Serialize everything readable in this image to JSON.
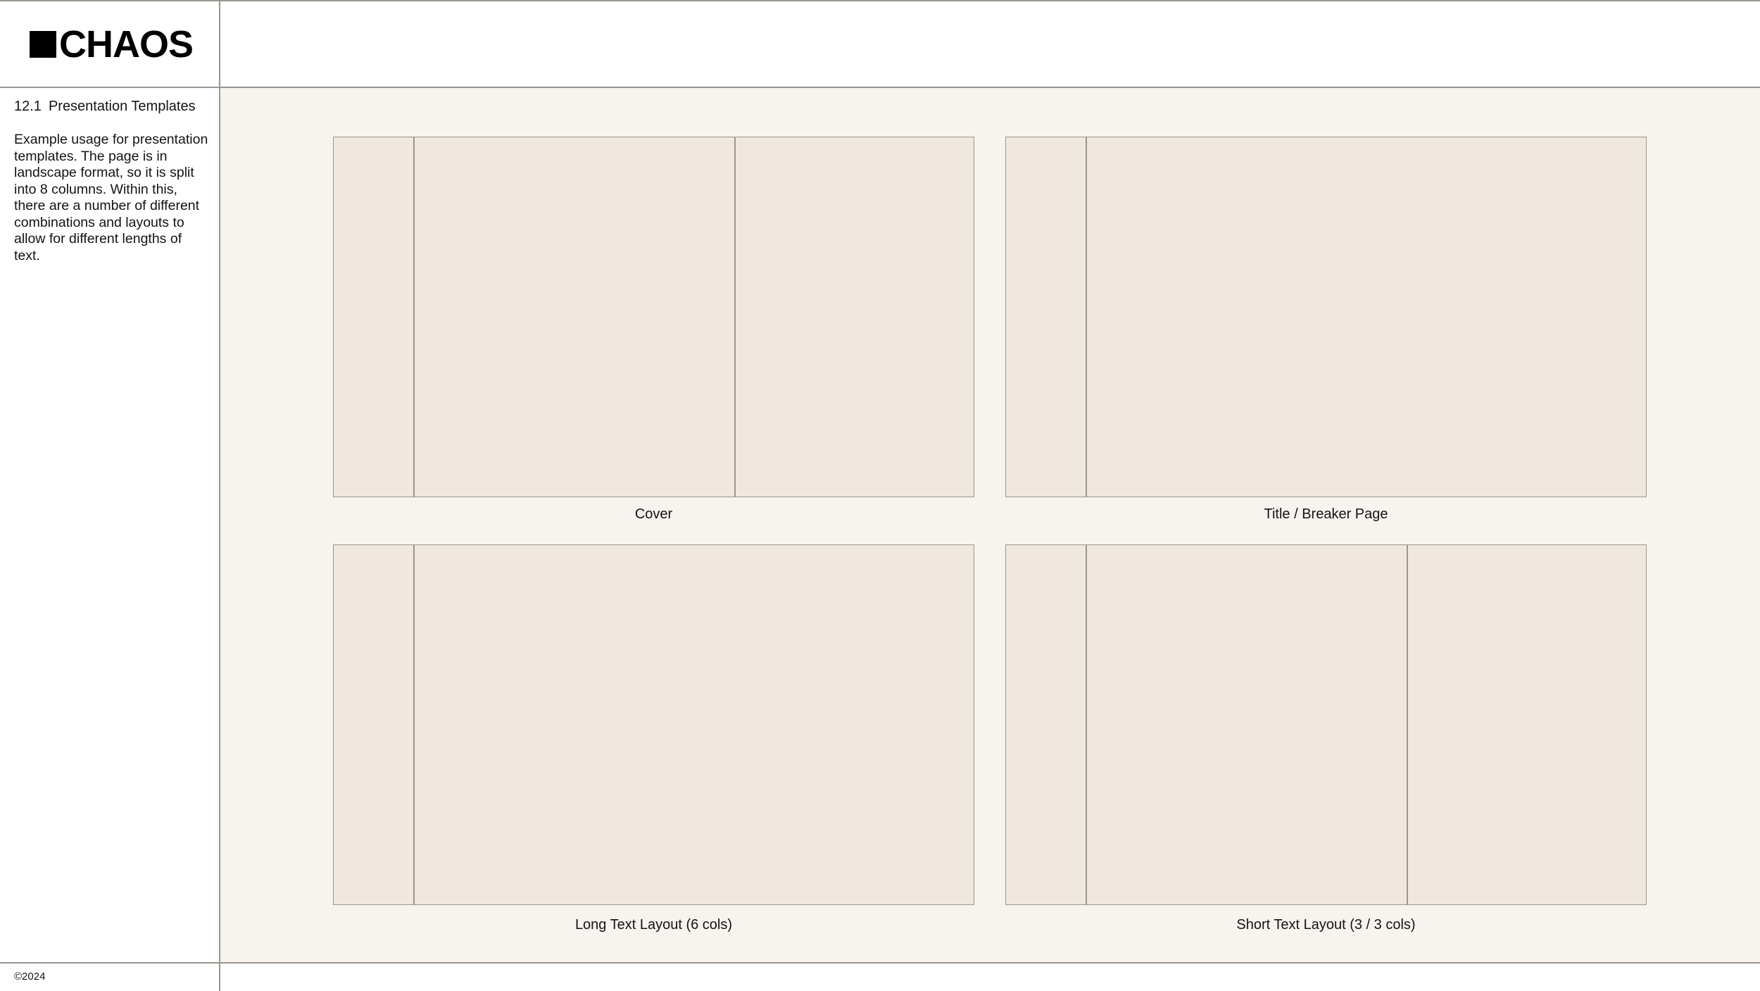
{
  "brand": {
    "logo_icon": "black-square",
    "name": "CHAOS"
  },
  "sidebar": {
    "section_number": "12.1",
    "section_title": "Presentation Templates",
    "description": "Example usage for presentation templates. The page is in landscape format, so it is split into 8 columns. Within this, there are a number of different combinations and layouts to allow for different lengths of text."
  },
  "footer": {
    "copyright": "©2024"
  },
  "templates": [
    {
      "caption": "Cover"
    },
    {
      "caption": "Title / Breaker Page"
    },
    {
      "caption": "Long Text Layout (6 cols)"
    },
    {
      "caption": "Short Text Layout (3 / 3 cols)"
    }
  ],
  "colors": {
    "panel_background": "#f7f3ee",
    "template_fill": "#f0e7de",
    "rule": "#9a9690",
    "text": "#141414"
  }
}
